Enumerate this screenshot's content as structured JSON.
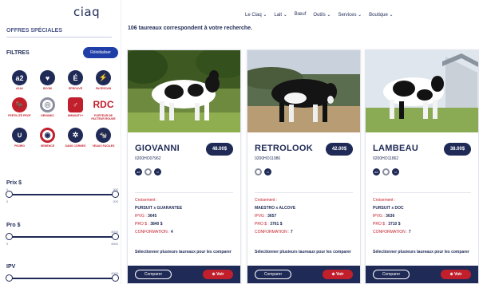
{
  "brand": {
    "logo": "ciaq"
  },
  "nav": {
    "items": [
      "Le Ciaq ⌄",
      "Lait ⌄",
      "Bœuf",
      "Outils ⌄",
      "Services ⌄",
      "Boutique ⌄"
    ]
  },
  "sidebar": {
    "offres": "OFFRES SPÉCIALES",
    "filtres": "FILTRES",
    "reinit": "Réinitialiser",
    "icons": [
      {
        "glyph": "a2",
        "label": "A2A2",
        "icon": "a2-badge-icon"
      },
      {
        "glyph": "♥",
        "label": "BCOM",
        "icon": "udder-icon"
      },
      {
        "glyph": "É",
        "label": "ÉPROUVÉ",
        "icon": "proven-e-icon"
      },
      {
        "glyph": "⚡",
        "label": "FACESCAN",
        "icon": "lightning-icon"
      },
      {
        "glyph": "🐂",
        "label": "FERTILITÉ PROF",
        "icon": "bull-head-icon"
      },
      {
        "glyph": "◎",
        "label": "GENOMIC",
        "icon": "genomic-ring-icon"
      },
      {
        "glyph": "♂",
        "label": "IMMUNITY+",
        "icon": "shield-icon"
      },
      {
        "glyph": "RDC",
        "label": "PORTEUR DE FACTEUR ROUGE",
        "icon": "rdc-text-icon"
      },
      {
        "glyph": "∪",
        "label": "PIS/IRG",
        "icon": "udder-curve-icon"
      },
      {
        "glyph": "◉",
        "label": "SEMENCE",
        "icon": "semence-ring-icon"
      },
      {
        "glyph": "✲",
        "label": "SANS CORNES",
        "icon": "polled-icon"
      },
      {
        "glyph": "🐄",
        "label": "VEAUX FACILES",
        "icon": "cow-head-icon"
      }
    ],
    "ranges": [
      {
        "title": "Prix $",
        "min_label": "0",
        "max_label": "200",
        "top_left": "0",
        "top_right": "200",
        "low": 0,
        "high": 1
      },
      {
        "title": "Pro $",
        "min_label": "0",
        "max_label": "4500",
        "top_left": "",
        "top_right": "4500",
        "low": 0,
        "high": 1
      },
      {
        "title": "IPV",
        "min_label": "",
        "max_label": "4000",
        "top_left": "",
        "top_right": "4000",
        "low": 0,
        "high": 1
      }
    ]
  },
  "results": {
    "text": "106 taureaux correspondent à votre recherche."
  },
  "labels": {
    "croisement": "Croisement :",
    "ipvg": "IPVG :",
    "pro": "PRO $ :",
    "conformation": "CONFORMATION :",
    "compare_note": "Sélectionner plusieurs taureaux pour les comparer",
    "comparer": "Comparer",
    "voir": "⊕ Voir"
  },
  "cards": [
    {
      "name": "GIOVANNI",
      "code": "0200HO07962",
      "price": "48.00$",
      "cross": "PURSUIT x GUARANTEE",
      "ipvg": "3645",
      "pro": "3840 $",
      "conformation": "4",
      "mini": [
        {
          "g": "a2",
          "t": "d"
        },
        {
          "g": "◎",
          "t": "g"
        },
        {
          "g": "∪",
          "t": "d"
        }
      ]
    },
    {
      "name": "RETROLOOK",
      "code": "0200HO11986",
      "price": "42.00$",
      "cross": "MAESTRO x ALCOVE",
      "ipvg": "3657",
      "pro": "3761 $",
      "conformation": "7",
      "mini": [
        {
          "g": "◎",
          "t": "g"
        },
        {
          "g": "∪",
          "t": "d"
        }
      ]
    },
    {
      "name": "LAMBEAU",
      "code": "0200HO11862",
      "price": "38.00$",
      "cross": "PURSUIT x DOC",
      "ipvg": "3636",
      "pro": "3710 $",
      "conformation": "7",
      "mini": [
        {
          "g": "a2",
          "t": "d"
        },
        {
          "g": "◎",
          "t": "g"
        },
        {
          "g": "∪",
          "t": "d"
        }
      ]
    }
  ]
}
